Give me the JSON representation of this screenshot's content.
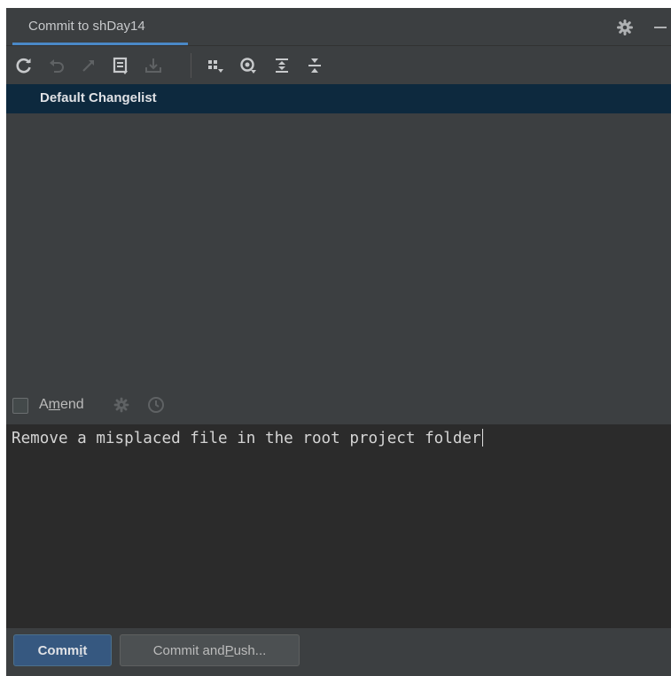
{
  "window": {
    "tab_title": "Commit to shDay14"
  },
  "toolbar": {
    "icons": [
      "refresh-icon",
      "rollback-icon",
      "jump-to-source-icon",
      "diff-icon",
      "shelve-icon",
      "group-by-icon",
      "view-options-icon",
      "expand-all-icon",
      "collapse-all-icon"
    ]
  },
  "changes": {
    "changelist_label": "Default Changelist"
  },
  "amend": {
    "label_pre": "A",
    "label_mnemonic": "m",
    "label_post": "end",
    "checked": false
  },
  "message": {
    "text": "Remove a misplaced file in the root project folder"
  },
  "buttons": {
    "commit_pre": "Comm",
    "commit_mnemonic": "i",
    "commit_post": "t",
    "push_pre": "Commit and ",
    "push_mnemonic": "P",
    "push_post": "ush..."
  },
  "colors": {
    "panel_bg": "#3c3f41",
    "editor_bg": "#2b2b2b",
    "selection_bg": "#0d293e",
    "accent": "#4a88c7",
    "primary_button": "#365880"
  }
}
